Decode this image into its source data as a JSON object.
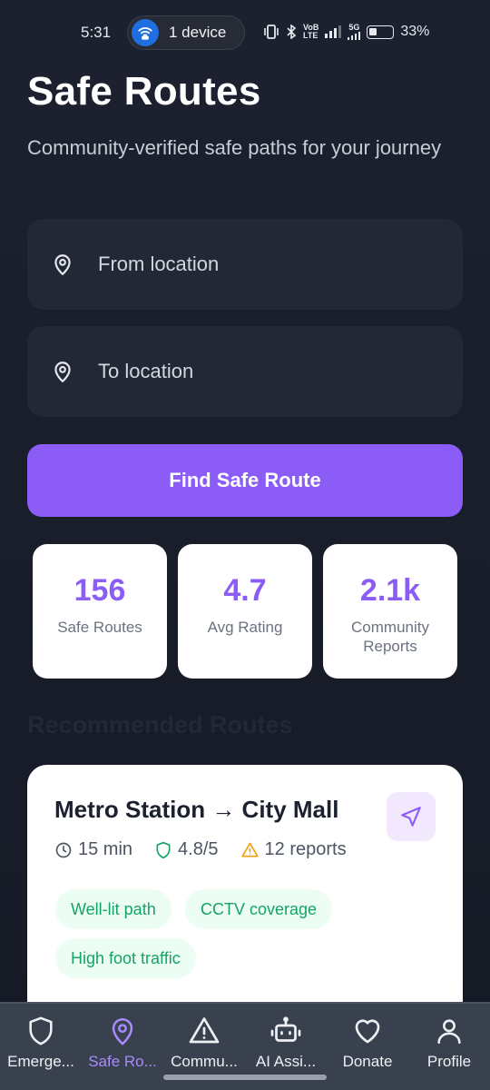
{
  "status_bar": {
    "time": "5:31",
    "hotspot_label": "1 device",
    "network_label_top": "VoB",
    "network_label_bottom": "LTE",
    "five_g_label": "5G",
    "battery": "33%"
  },
  "header": {
    "title": "Safe Routes",
    "subtitle": "Community-verified safe paths for your journey"
  },
  "form": {
    "from_placeholder": "From location",
    "to_placeholder": "To location",
    "find_button": "Find Safe Route"
  },
  "stats": [
    {
      "value": "156",
      "label": "Safe Routes"
    },
    {
      "value": "4.7",
      "label": "Avg Rating"
    },
    {
      "value": "2.1k",
      "label": "Community Reports"
    }
  ],
  "section_title": "Recommended Routes",
  "route": {
    "title": "Metro Station → City Mall",
    "duration": "15 min",
    "rating": "4.8/5",
    "reports": "12 reports",
    "tags": [
      "Well-lit path",
      "CCTV coverage",
      "High foot traffic"
    ]
  },
  "bottom_nav": [
    {
      "label": "Emerge...",
      "icon": "shield-icon",
      "active": false
    },
    {
      "label": "Safe Ro...",
      "icon": "map-pin-icon",
      "active": true
    },
    {
      "label": "Commu...",
      "icon": "alert-triangle-icon",
      "active": false
    },
    {
      "label": "AI Assi...",
      "icon": "robot-icon",
      "active": false
    },
    {
      "label": "Donate",
      "icon": "heart-icon",
      "active": false
    },
    {
      "label": "Profile",
      "icon": "user-icon",
      "active": false
    }
  ],
  "colors": {
    "accent": "#8b5cf6",
    "background": "#1c2130",
    "tag_green": "#16a365",
    "warning": "#f59e0b"
  }
}
